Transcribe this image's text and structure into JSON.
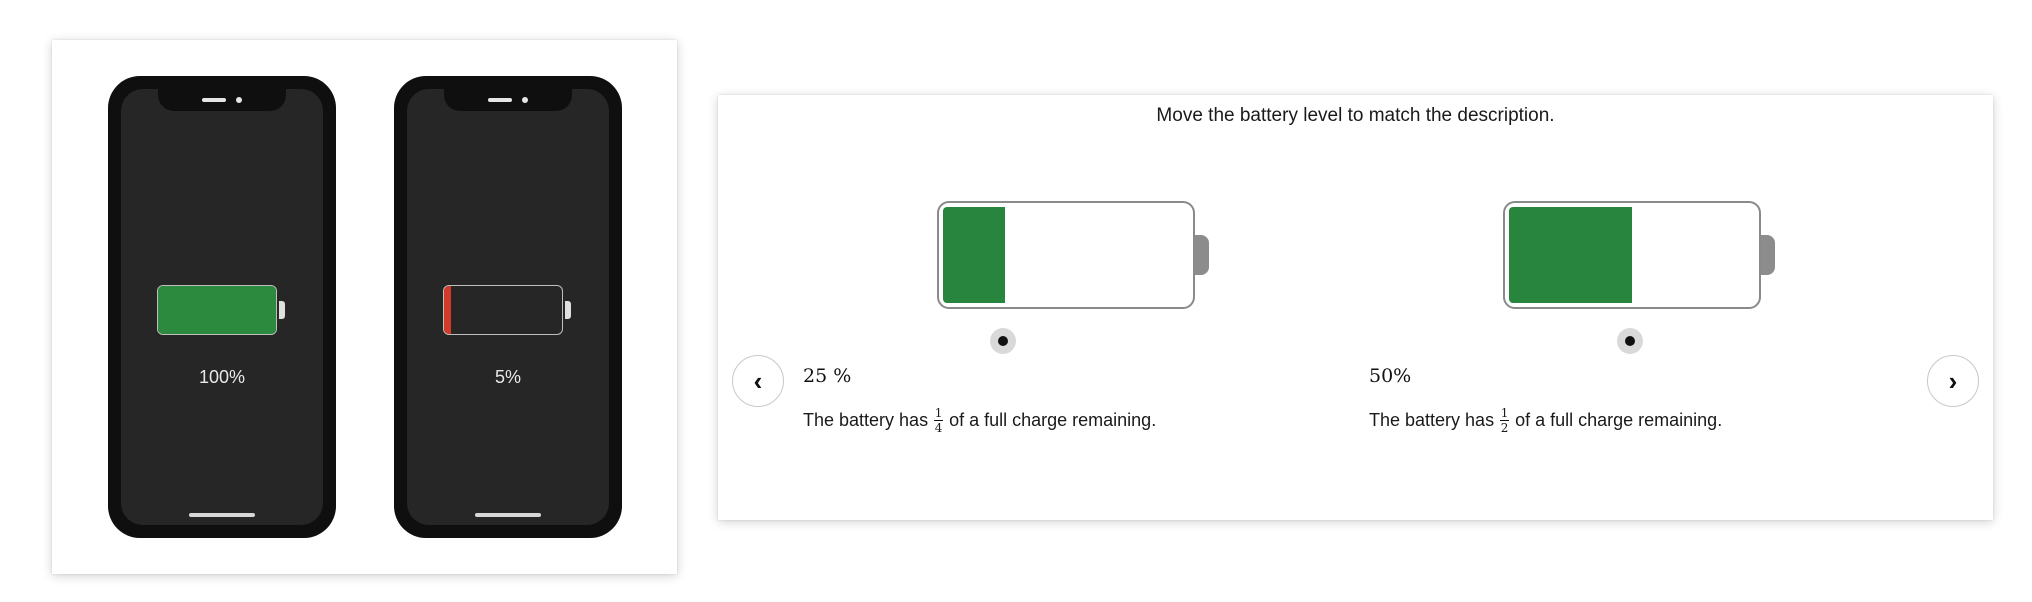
{
  "phones": [
    {
      "percent_label": "100%",
      "level": 1.0,
      "fill_color": "#2b8a3e"
    },
    {
      "percent_label": "5%",
      "level": 0.05,
      "fill_color": "#d23a2a"
    }
  ],
  "activity": {
    "instruction": "Move the battery level to match the description.",
    "items": [
      {
        "value_label": "25 %",
        "level": 0.25,
        "desc_before": "The battery has",
        "frac_num": "1",
        "frac_den": "4",
        "desc_after": "of a full charge remaining."
      },
      {
        "value_label": "50%",
        "level": 0.5,
        "desc_before": "The battery has",
        "frac_num": "1",
        "frac_den": "2",
        "desc_after": "of a full charge remaining."
      }
    ],
    "prev_icon": "chevron-left-icon",
    "next_icon": "chevron-right-icon",
    "accent_color": "#28853d"
  }
}
